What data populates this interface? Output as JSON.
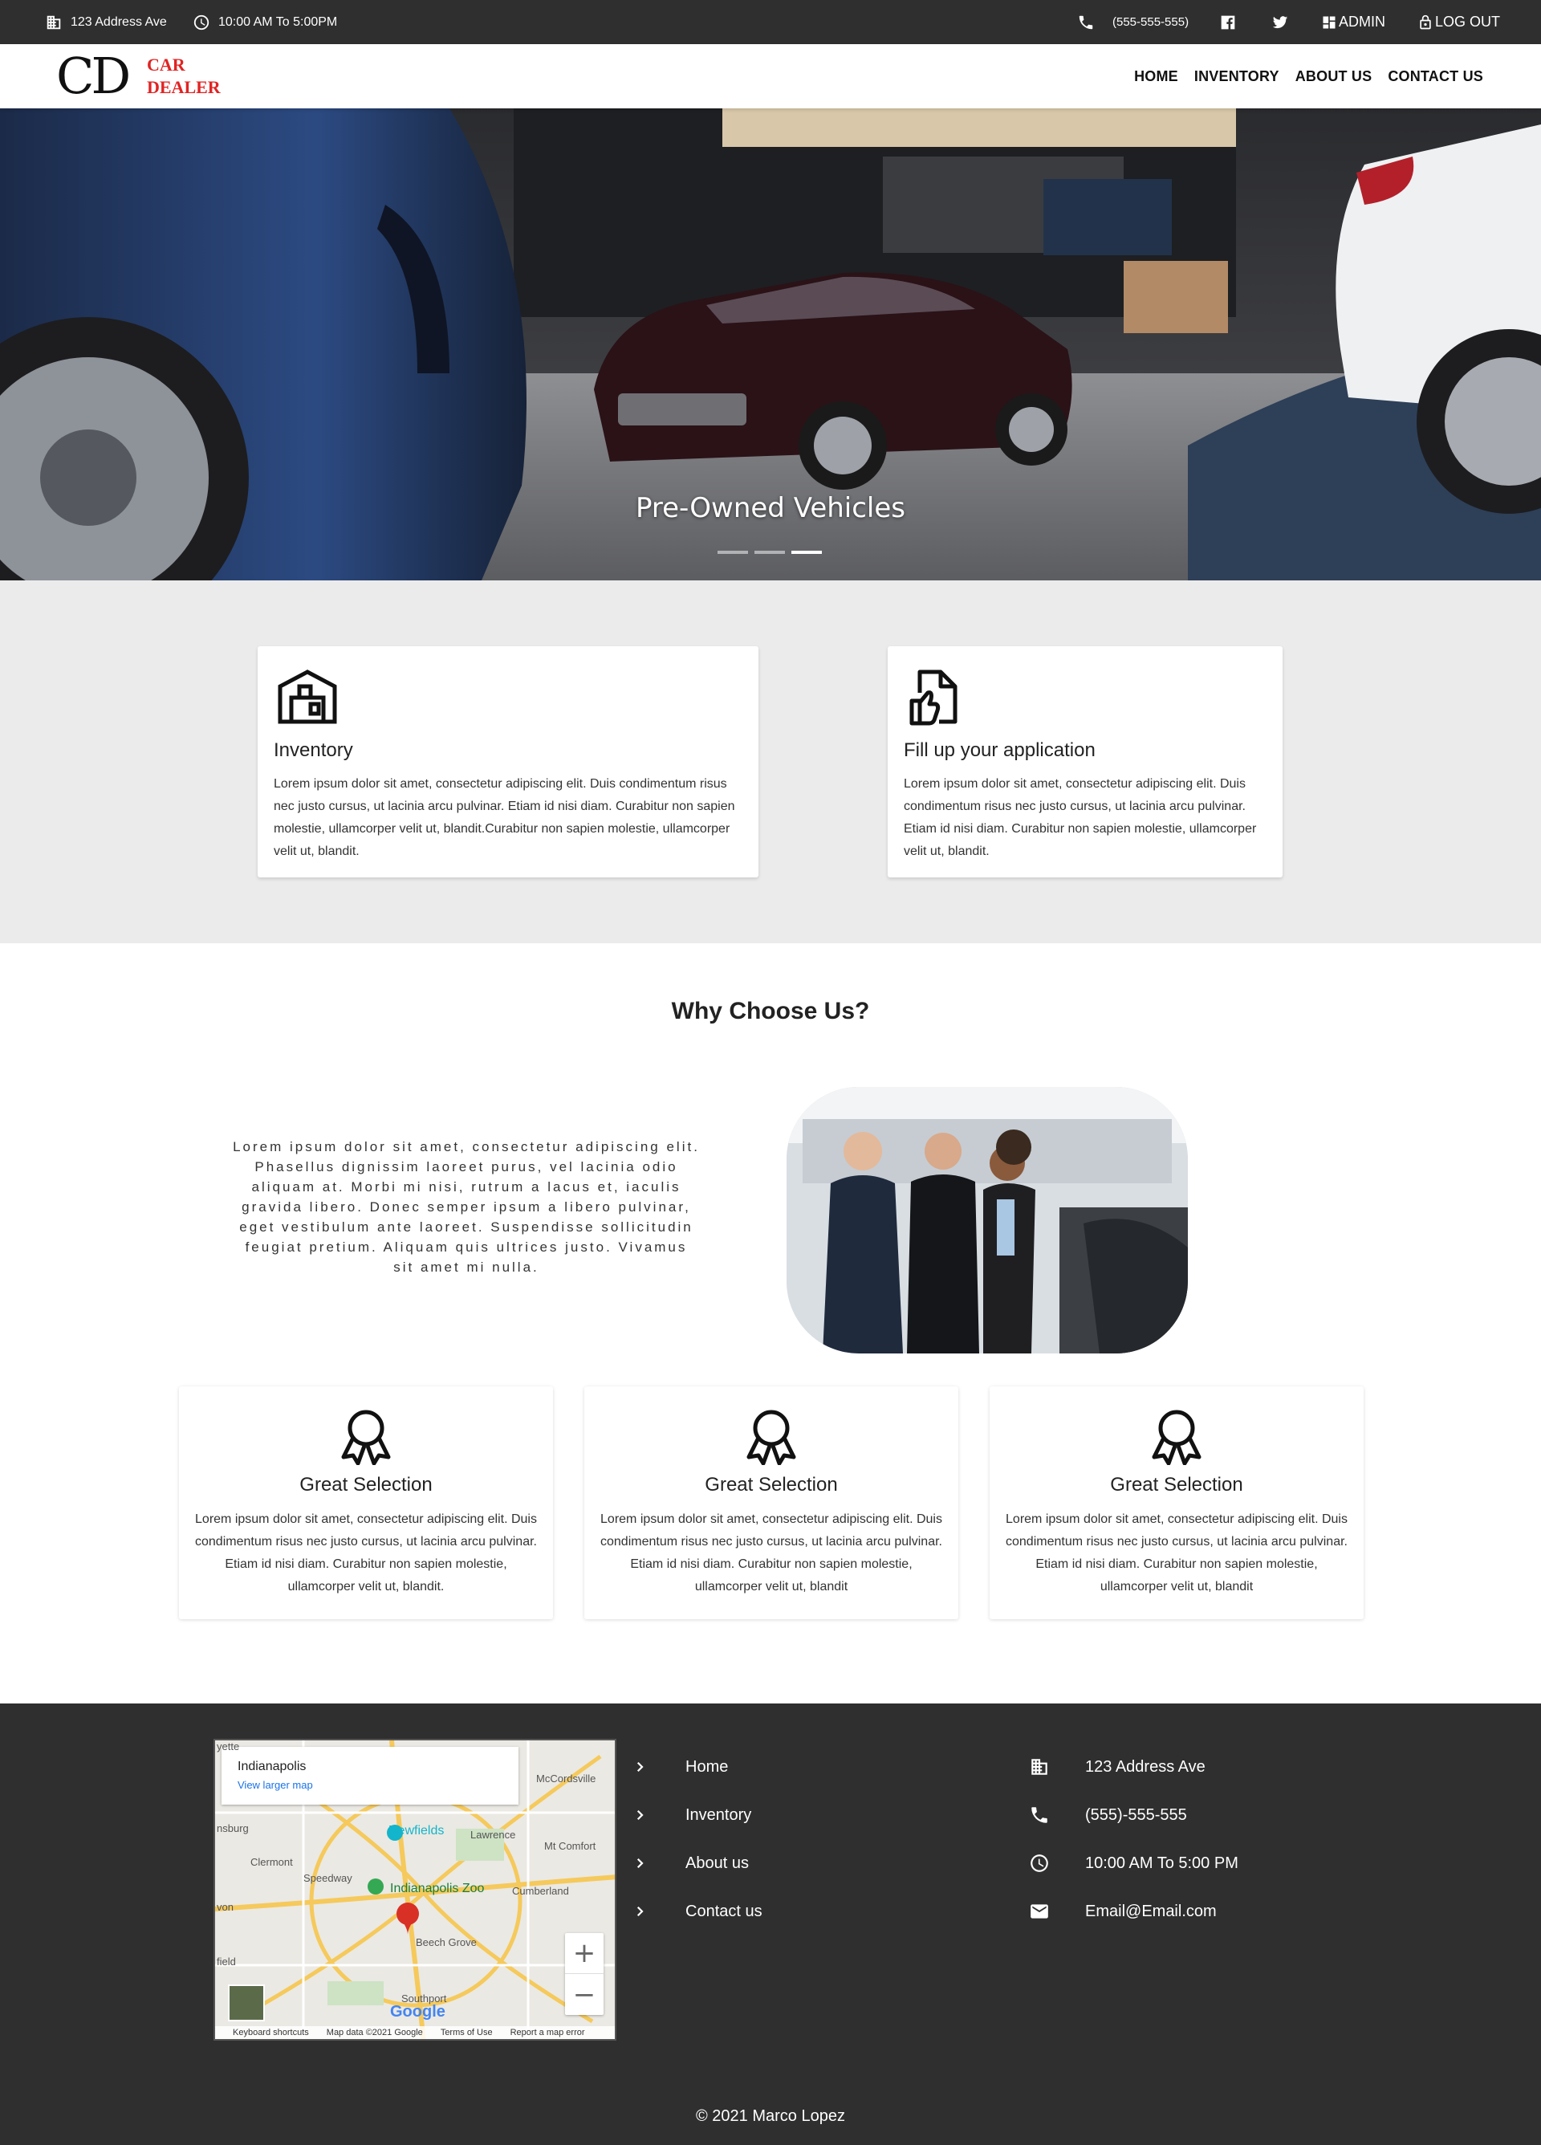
{
  "topbar": {
    "address": "123 Address Ave",
    "hours": "10:00 AM To 5:00PM",
    "phone": "(555-555-555)",
    "admin_label": "ADMIN",
    "logout_label": "LOG OUT"
  },
  "logo": {
    "mark": "CD",
    "line1": "CAR",
    "line2": "DEALER"
  },
  "nav": {
    "items": [
      "HOME",
      "INVENTORY",
      "ABOUT US",
      "CONTACT US"
    ]
  },
  "hero": {
    "caption": "Pre-Owned Vehicles",
    "slides": 3,
    "active_slide": 3
  },
  "cards": [
    {
      "title": "Inventory",
      "text": "Lorem ipsum dolor sit amet, consectetur adipiscing elit. Duis condimentum risus nec justo cursus, ut lacinia arcu pulvinar. Etiam id nisi diam. Curabitur non sapien molestie, ullamcorper velit ut, blandit.Curabitur non sapien molestie, ullamcorper velit ut, blandit.",
      "icon": "warehouse-icon"
    },
    {
      "title": "Fill up your application",
      "text": "Lorem ipsum dolor sit amet, consectetur adipiscing elit. Duis condimentum risus nec justo cursus, ut lacinia arcu pulvinar. Etiam id nisi diam. Curabitur non sapien molestie, ullamcorper velit ut, blandit.",
      "icon": "document-thumbs-up-icon"
    }
  ],
  "why": {
    "title": "Why Choose Us?",
    "text": "Lorem ipsum dolor sit amet, consectetur adipiscing elit. Phasellus dignissim laoreet purus, vel lacinia odio aliquam at. Morbi mi nisi, rutrum a lacus et, iaculis gravida libero. Donec semper ipsum a libero pulvinar, eget vestibulum ante laoreet. Suspendisse sollicitudin feugiat pretium. Aliquam quis ultrices justo. Vivamus sit amet mi nulla."
  },
  "features": [
    {
      "title": "Great Selection",
      "text": "Lorem ipsum dolor sit amet, consectetur adipiscing elit. Duis condimentum risus nec justo cursus, ut lacinia arcu pulvinar. Etiam id nisi diam. Curabitur non sapien molestie, ullamcorper velit ut, blandit.",
      "icon": "award-ribbon-icon"
    },
    {
      "title": "Great Selection",
      "text": "Lorem ipsum dolor sit amet, consectetur adipiscing elit. Duis condimentum risus nec justo cursus, ut lacinia arcu pulvinar. Etiam id nisi diam. Curabitur non sapien molestie, ullamcorper velit ut, blandit",
      "icon": "award-ribbon-icon"
    },
    {
      "title": "Great Selection",
      "text": "Lorem ipsum dolor sit amet, consectetur adipiscing elit. Duis condimentum risus nec justo cursus, ut lacinia arcu pulvinar. Etiam id nisi diam. Curabitur non sapien molestie, ullamcorper velit ut, blandit",
      "icon": "award-ribbon-icon"
    }
  ],
  "map": {
    "city": "Indianapolis",
    "larger_map": "View larger map",
    "place1": "Newfields",
    "place2": "Indianapolis Zoo",
    "labels": [
      "McCordsville",
      "Lawrence",
      "Mt Comfort",
      "Clermont",
      "Speedway",
      "Cumberland",
      "Beech Grove",
      "Southport",
      "nsburg",
      "yette",
      "field",
      "von"
    ],
    "brand": "Google",
    "footer": [
      "Keyboard shortcuts",
      "Map data ©2021 Google",
      "Terms of Use",
      "Report a map error"
    ],
    "zoom_in": "+",
    "zoom_out": "−"
  },
  "footer": {
    "links": [
      "Home",
      "Inventory",
      "About us",
      "Contact us"
    ],
    "address": "123 Address Ave",
    "phone": "(555)-555-555",
    "hours": "10:00 AM To 5:00 PM",
    "email": "Email@Email.com",
    "copyright": "© 2021 Marco Lopez"
  },
  "colors": {
    "topbar": "#2f2f2f",
    "brand_red": "#e02424",
    "section_gray": "#ebebeb",
    "footer": "#2f2f2f"
  }
}
